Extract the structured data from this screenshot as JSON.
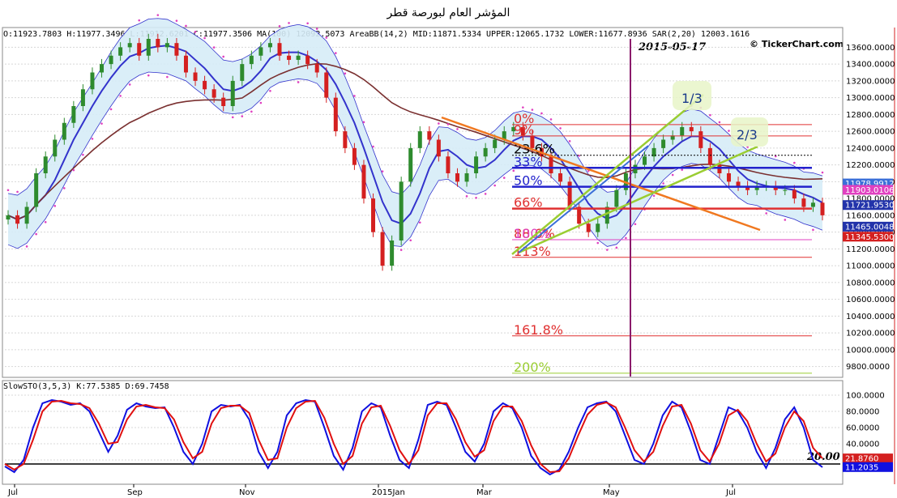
{
  "page": {
    "title": "المؤشر العام لبورصة قطر"
  },
  "watermark": "© TickerChart.com",
  "date_label": "2015-05-17",
  "main_header": "O:11923.7803 H:11977.3496 L:11912.6201 C:11977.3506 MA(100) 12092.5073 AreaBB(14,2) MID:11871.5334 UPPER:12065.1732 LOWER:11677.8936 SAR(2,20) 12003.1616",
  "sto_header": "SlowSTO(3,5,3) K:77.5385 D:69.7458",
  "colors": {
    "candle_up": "#2e8b2e",
    "candle_down": "#d42020",
    "bb_fill": "#d6ecf7",
    "bb_line": "#3333cc",
    "ma_line": "#7a3030",
    "sar": "#e040c0",
    "fib_red": "#e03030",
    "trend_orange": "#f07820",
    "trend_green": "#9acd32",
    "sto_k": "#1010e0",
    "sto_d": "#e01010",
    "vline": "#8b1a6b"
  },
  "chart_data": [
    {
      "type": "candlestick",
      "x_ticks": [
        "Jul",
        "Sep",
        "Nov",
        "2015Jan",
        "Mar",
        "May",
        "Jul"
      ],
      "y_ticks": [
        "13600.0000",
        "13400.0000",
        "13200.0000",
        "13000.0000",
        "12800.0000",
        "12600.0000",
        "12400.0000",
        "12200.0000",
        "12000.0000",
        "11800.0000",
        "11600.0000",
        "11400.0000",
        "11200.0000",
        "11000.0000",
        "10800.0000",
        "10600.0000",
        "10400.0000",
        "10200.0000",
        "10000.0000",
        "9800.0000"
      ],
      "ylim": [
        9700,
        13700
      ],
      "indicators": [
        "MA(100)",
        "AreaBB(14,2)",
        "SAR(2,20)"
      ],
      "series": [
        {
          "name": "Close",
          "values": [
            11600,
            11500,
            11700,
            12100,
            12300,
            12500,
            12700,
            12900,
            13100,
            13300,
            13400,
            13500,
            13600,
            13650,
            13500,
            13700,
            13600,
            13650,
            13500,
            13300,
            13200,
            13100,
            13000,
            12900,
            13200,
            13400,
            13500,
            13600,
            13650,
            13500,
            13450,
            13500,
            13400,
            13300,
            13000,
            12600,
            12400,
            12200,
            11800,
            11400,
            11000,
            11300,
            12000,
            12400,
            12600,
            12500,
            12300,
            12100,
            12000,
            12100,
            12300,
            12400,
            12500,
            12600,
            12650,
            12550,
            12400,
            12300,
            12100,
            12000,
            11700,
            11500,
            11400,
            11500,
            11700,
            11900,
            12100,
            12200,
            12300,
            12400,
            12500,
            12550,
            12650,
            12600,
            12400,
            12200,
            12100,
            12000,
            11950,
            11900,
            11950,
            11950,
            11900,
            11900,
            11800,
            11700,
            11750,
            11600
          ]
        }
      ],
      "price_badges": [
        {
          "label": "11978.9912",
          "color": "#3a6fd8",
          "value": 11978.9912
        },
        {
          "label": "11903.0106",
          "color": "#e040c0",
          "value": 11903.0106
        },
        {
          "label": "11721.9530",
          "color": "#2233aa",
          "value": 11721.953
        },
        {
          "label": "11465.0048",
          "color": "#2233aa",
          "value": 11465.0048
        },
        {
          "label": "11345.5300",
          "color": "#d42020",
          "value": 11345.53
        }
      ],
      "fibonacci": [
        {
          "label": "0%",
          "value": 12680,
          "color": "#e03030"
        },
        {
          "label": "9%",
          "value": 12545,
          "color": "#e03030"
        },
        {
          "label": "23.6%",
          "value": 12315,
          "color": "#000000"
        },
        {
          "label": "33%",
          "value": 12165,
          "color": "#2222cc"
        },
        {
          "label": "50%",
          "value": 11940,
          "color": "#2222cc"
        },
        {
          "label": "66%",
          "value": 11680,
          "color": "#e03030"
        },
        {
          "label": "88.6%",
          "value": 11310,
          "color": "#e03030"
        },
        {
          "label": "100%",
          "value": 11310,
          "color": "#e040c0"
        },
        {
          "label": "113%",
          "value": 11100,
          "color": "#e03030"
        },
        {
          "label": "161.8%",
          "value": 10165,
          "color": "#e03030"
        },
        {
          "label": "200%",
          "value": 9720,
          "color": "#9acd32"
        }
      ],
      "fan_labels": [
        "1/3",
        "2/3"
      ]
    },
    {
      "type": "line",
      "name": "SlowSTO(3,5,3)",
      "y_ticks": [
        "100.0000",
        "80.0000",
        "60.0000",
        "40.0000",
        "20.0000"
      ],
      "ylim": [
        -8,
        106
      ],
      "reference_line": {
        "label": "20.00",
        "value": 15
      },
      "badges": [
        {
          "label": "21.8760",
          "color": "#d42020",
          "value": 21.876
        },
        {
          "label": "11.2035",
          "color": "#1010e0",
          "value": 11.2035
        }
      ],
      "series": [
        {
          "name": "K",
          "values": [
            12,
            5,
            20,
            60,
            90,
            94,
            92,
            88,
            90,
            80,
            55,
            30,
            50,
            82,
            90,
            86,
            84,
            85,
            60,
            30,
            15,
            40,
            80,
            88,
            86,
            88,
            70,
            30,
            10,
            30,
            75,
            90,
            94,
            92,
            60,
            25,
            8,
            35,
            80,
            90,
            85,
            50,
            20,
            10,
            45,
            88,
            92,
            88,
            60,
            30,
            18,
            40,
            80,
            90,
            84,
            60,
            25,
            10,
            2,
            8,
            30,
            60,
            85,
            90,
            92,
            80,
            50,
            20,
            15,
            40,
            75,
            92,
            85,
            55,
            20,
            15,
            50,
            85,
            80,
            60,
            30,
            10,
            35,
            70,
            85,
            60,
            20,
            11
          ]
        },
        {
          "name": "D",
          "values": [
            15,
            8,
            15,
            45,
            80,
            92,
            93,
            90,
            89,
            84,
            65,
            40,
            42,
            70,
            86,
            88,
            85,
            84,
            70,
            42,
            22,
            30,
            65,
            84,
            87,
            87,
            78,
            45,
            20,
            22,
            60,
            84,
            92,
            93,
            72,
            40,
            15,
            25,
            65,
            85,
            87,
            62,
            32,
            15,
            32,
            75,
            90,
            90,
            70,
            42,
            24,
            32,
            68,
            86,
            86,
            68,
            38,
            15,
            5,
            6,
            22,
            50,
            76,
            88,
            91,
            85,
            60,
            32,
            18,
            30,
            62,
            86,
            88,
            65,
            32,
            18,
            40,
            75,
            82,
            68,
            40,
            18,
            28,
            60,
            80,
            68,
            35,
            21.9
          ]
        }
      ]
    }
  ]
}
